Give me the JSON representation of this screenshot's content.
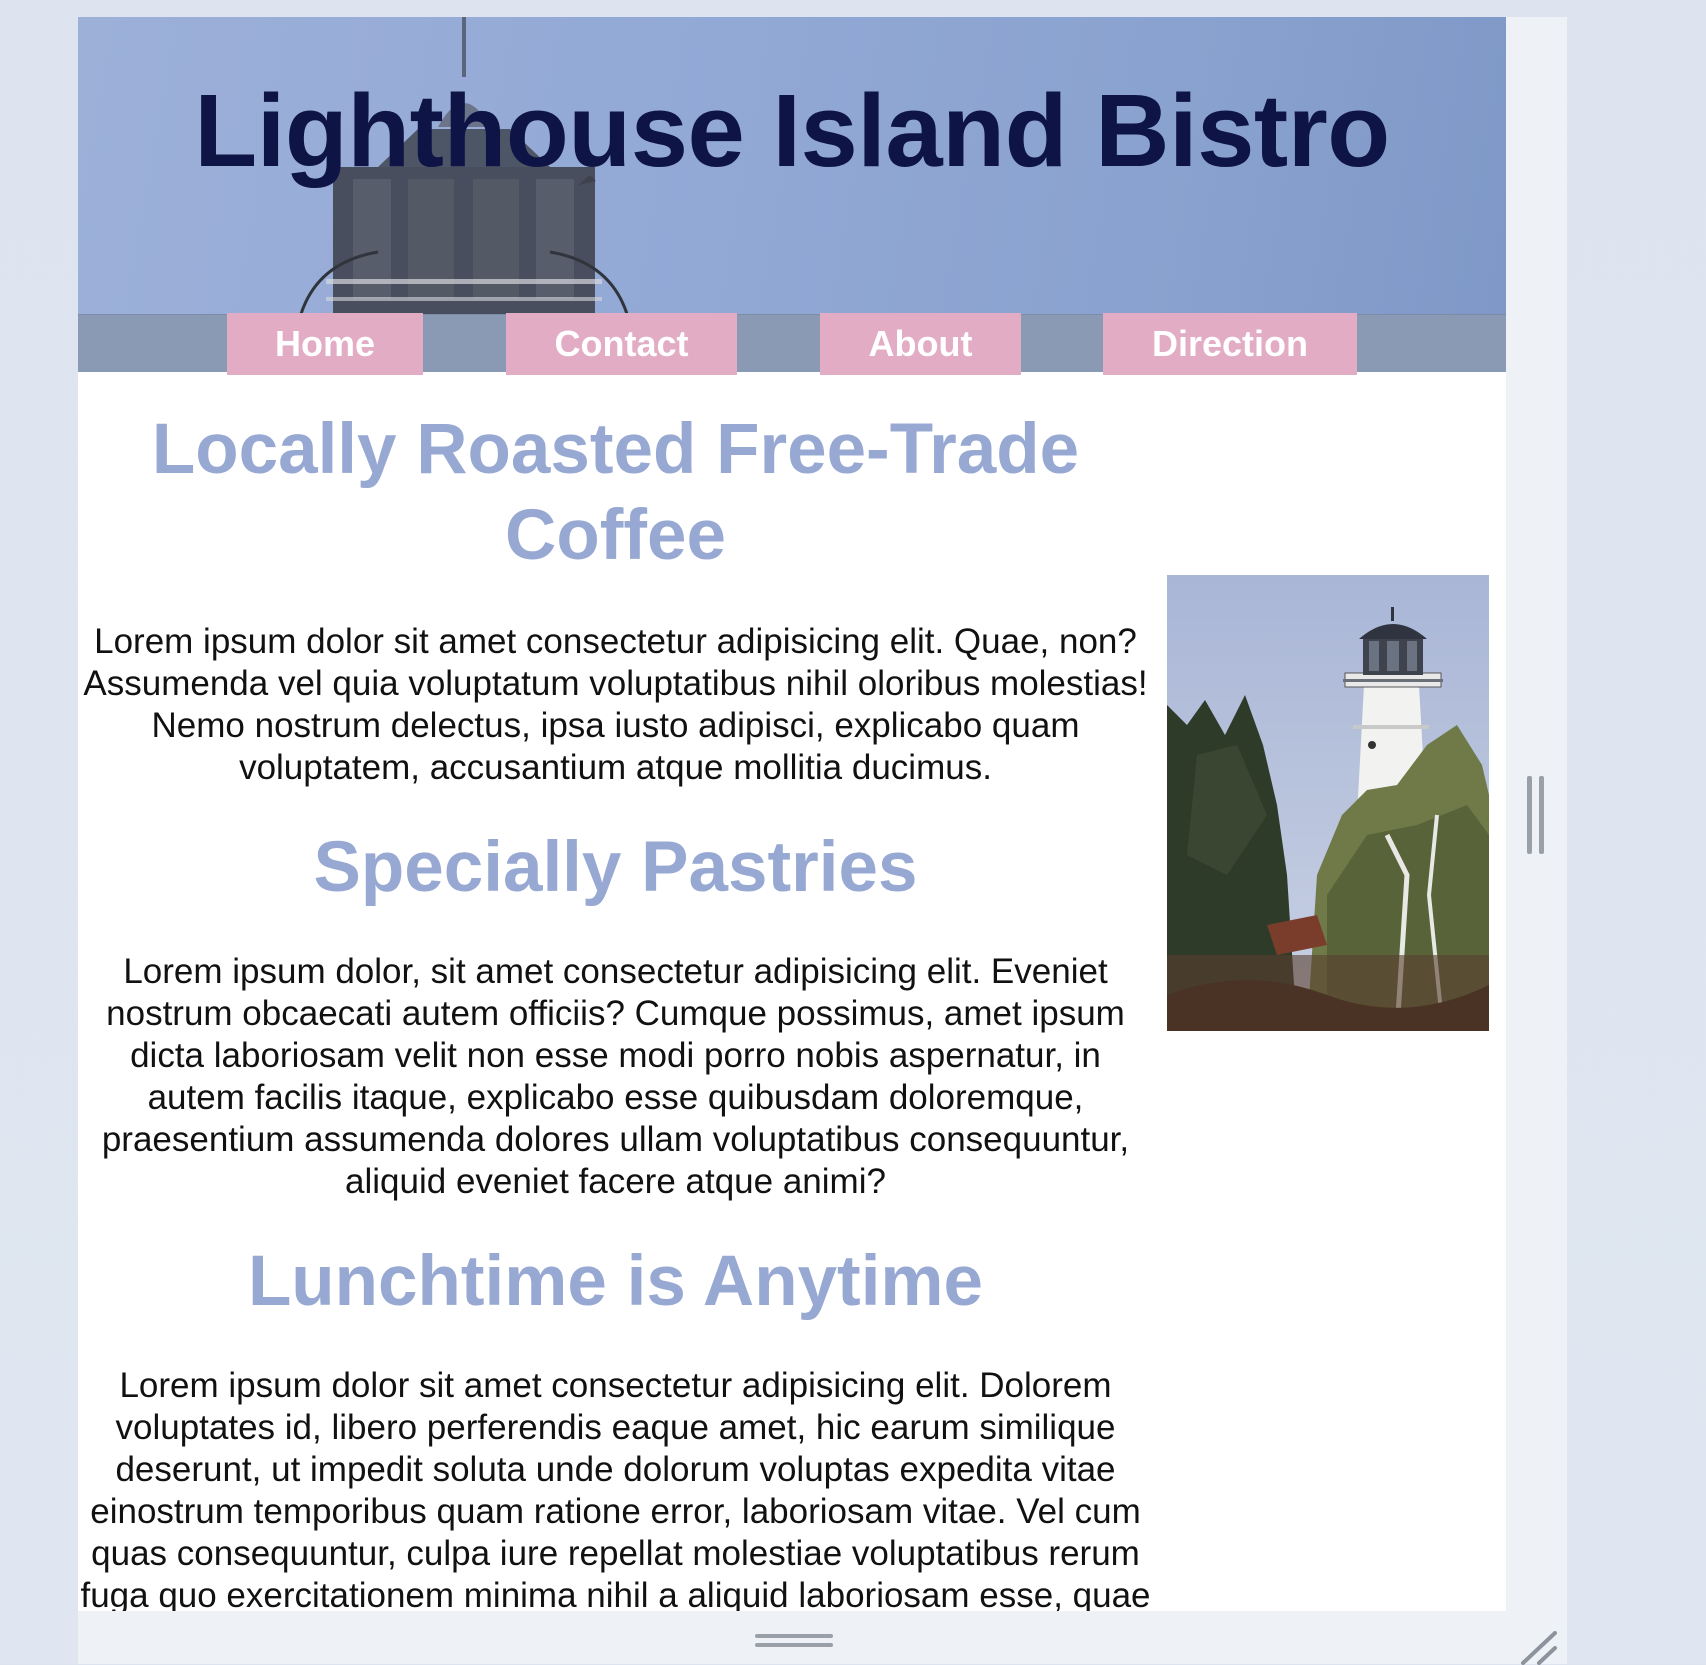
{
  "site": {
    "title": "Lighthouse Island Bistro"
  },
  "nav": {
    "items": [
      {
        "label": "Home"
      },
      {
        "label": "Contact"
      },
      {
        "label": "About"
      },
      {
        "label": "Direction"
      }
    ]
  },
  "sections": [
    {
      "heading": "Locally Roasted Free-Trade Coffee",
      "body": "Lorem ipsum dolor sit amet consectetur adipisicing elit. Quae, non? Assumenda vel quia voluptatum voluptatibus nihil oloribus molestias! Nemo nostrum delectus, ipsa iusto adipisci, explicabo quam voluptatem, accusantium atque mollitia ducimus."
    },
    {
      "heading": "Specially Pastries",
      "body": "Lorem ipsum dolor, sit amet consectetur adipisicing elit. Eveniet nostrum obcaecati autem officiis? Cumque possimus, amet ipsum dicta laboriosam velit non esse modi porro nobis aspernatur, in autem facilis itaque, explicabo esse quibusdam doloremque, praesentium assumenda dolores ullam voluptatibus consequuntur, aliquid eveniet facere atque animi?"
    },
    {
      "heading": "Lunchtime is Anytime",
      "body": "Lorem ipsum dolor sit amet consectetur adipisicing elit. Dolorem voluptates id, libero perferendis eaque amet, hic earum similique deserunt, ut impedit soluta unde dolorum voluptas expedita vitae einostrum temporibus quam ratione error, laboriosam vitae. Vel cum quas consequuntur, culpa iure repellat molestiae voluptatibus rerum fuga quo exercitationem minima nihil a aliquid laboriosam esse, quae magnam harum provident quam?"
    }
  ],
  "icons": {
    "banner": "lighthouse-lantern-icon",
    "photo": "lighthouse-photo-icon",
    "vertical_grip": "drag-handle-vertical-icon",
    "horizontal_grip": "drag-handle-horizontal-icon",
    "resize": "resize-corner-icon"
  },
  "colors": {
    "title": "#0e1446",
    "heading": "#97a8d2",
    "nav_bar": "#8a9ab4",
    "nav_button": "#e2adc4",
    "banner": "#93a9d6"
  }
}
